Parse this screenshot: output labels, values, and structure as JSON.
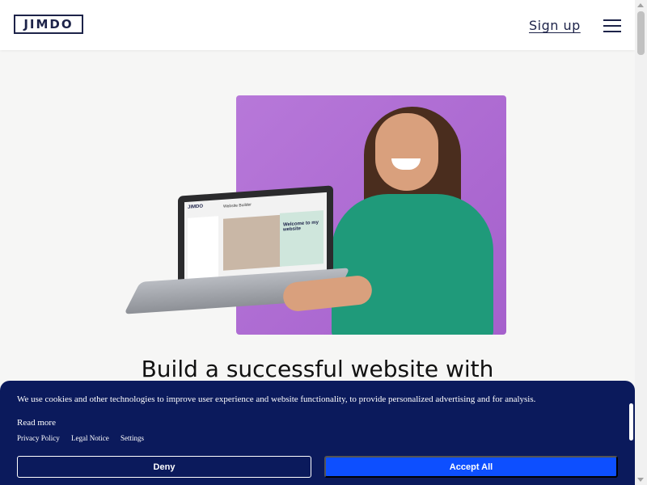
{
  "header": {
    "logo_text": "JIMDO",
    "signup_label": "Sign up",
    "menu_icon": "hamburger-menu-icon"
  },
  "hero": {
    "headline": "Build a successful website with",
    "laptop_brand": "JIMDO",
    "laptop_title": "Website Builder",
    "laptop_welcome": "Welcome to my website",
    "background_color": "#b778d9"
  },
  "cookie_banner": {
    "text": "We use cookies and other technologies to improve user experience and website functionality, to provide personalized advertising and for analysis.",
    "read_more": "Read more",
    "links": [
      "Privacy Policy",
      "Legal Notice",
      "Settings"
    ],
    "deny_label": "Deny",
    "accept_label": "Accept All",
    "background_color": "#0b1a5c",
    "accept_color": "#0d4fff"
  }
}
